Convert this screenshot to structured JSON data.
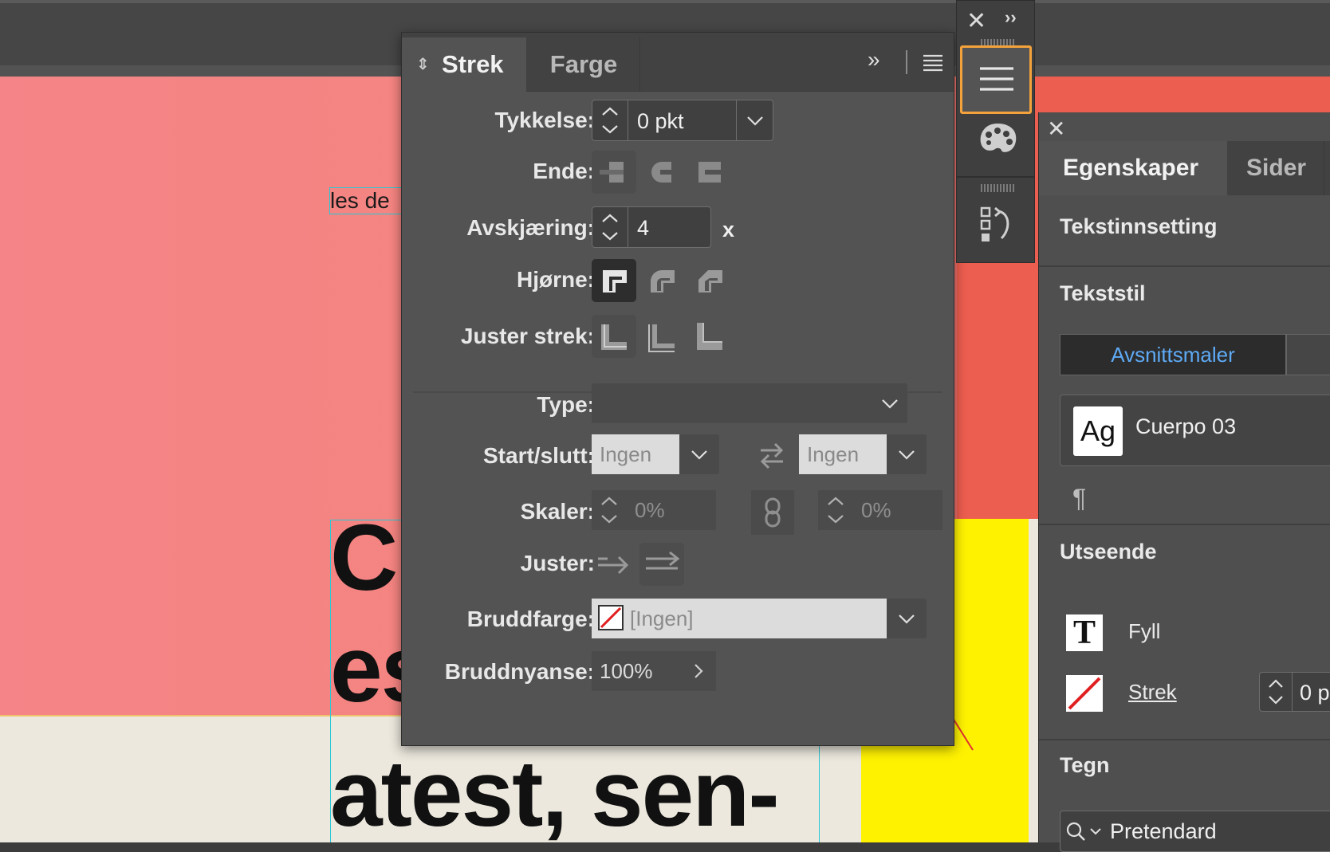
{
  "canvas": {
    "small_text": "les de",
    "big_text_lines": [
      "C",
      "es",
      "atest, sen-"
    ]
  },
  "stroke_panel": {
    "tabs": [
      {
        "label": "Strek"
      },
      {
        "label": "Farge"
      }
    ],
    "more_glyph": "»",
    "rows": {
      "tykkelse": {
        "label": "Tykkelse:",
        "value": "0 pkt"
      },
      "ende": {
        "label": "Ende:"
      },
      "avskjaering": {
        "label": "Avskjæring:",
        "value": "4",
        "suffix": "x"
      },
      "hjorne": {
        "label": "Hjørne:"
      },
      "juster_strek": {
        "label": "Juster strek:"
      },
      "type": {
        "label": "Type:",
        "value": ""
      },
      "start_slutt": {
        "label": "Start/slutt:",
        "start": "Ingen",
        "end": "Ingen"
      },
      "skaler": {
        "label": "Skaler:",
        "start": "0%",
        "end": "0%"
      },
      "juster": {
        "label": "Juster:"
      },
      "bruddfarge": {
        "label": "Bruddfarge:",
        "value": "[Ingen]"
      },
      "bruddnyanse": {
        "label": "Bruddnyanse:",
        "value": "100%"
      }
    }
  },
  "dock": {
    "close_glyph": "✕",
    "expand_glyph": "››",
    "icons": [
      "menu-icon",
      "palette-icon",
      "history-icon"
    ]
  },
  "properties_panel": {
    "close_glyph": "✕",
    "tabs": [
      {
        "label": "Egenskaper"
      },
      {
        "label": "Sider"
      }
    ],
    "sections": {
      "tekstinnsetting": "Tekstinnsetting",
      "tekststil": "Tekststil",
      "utseende": "Utseende",
      "tegn": "Tegn"
    },
    "style_tab": "Avsnittsmaler",
    "style_sample": "Ag",
    "style_name": "Cuerpo 03",
    "pilcrow": "¶",
    "fill_label": "Fyll",
    "fill_icon_glyph": "T",
    "stroke_label": "Strek",
    "stroke_value": "0 p",
    "font_value": "Pretendard"
  },
  "colors": {
    "accent_orange": "#f4a23c",
    "link_blue": "#5eaaf5",
    "canvas_pink": "#f48487",
    "canvas_yellow": "#fff200"
  }
}
